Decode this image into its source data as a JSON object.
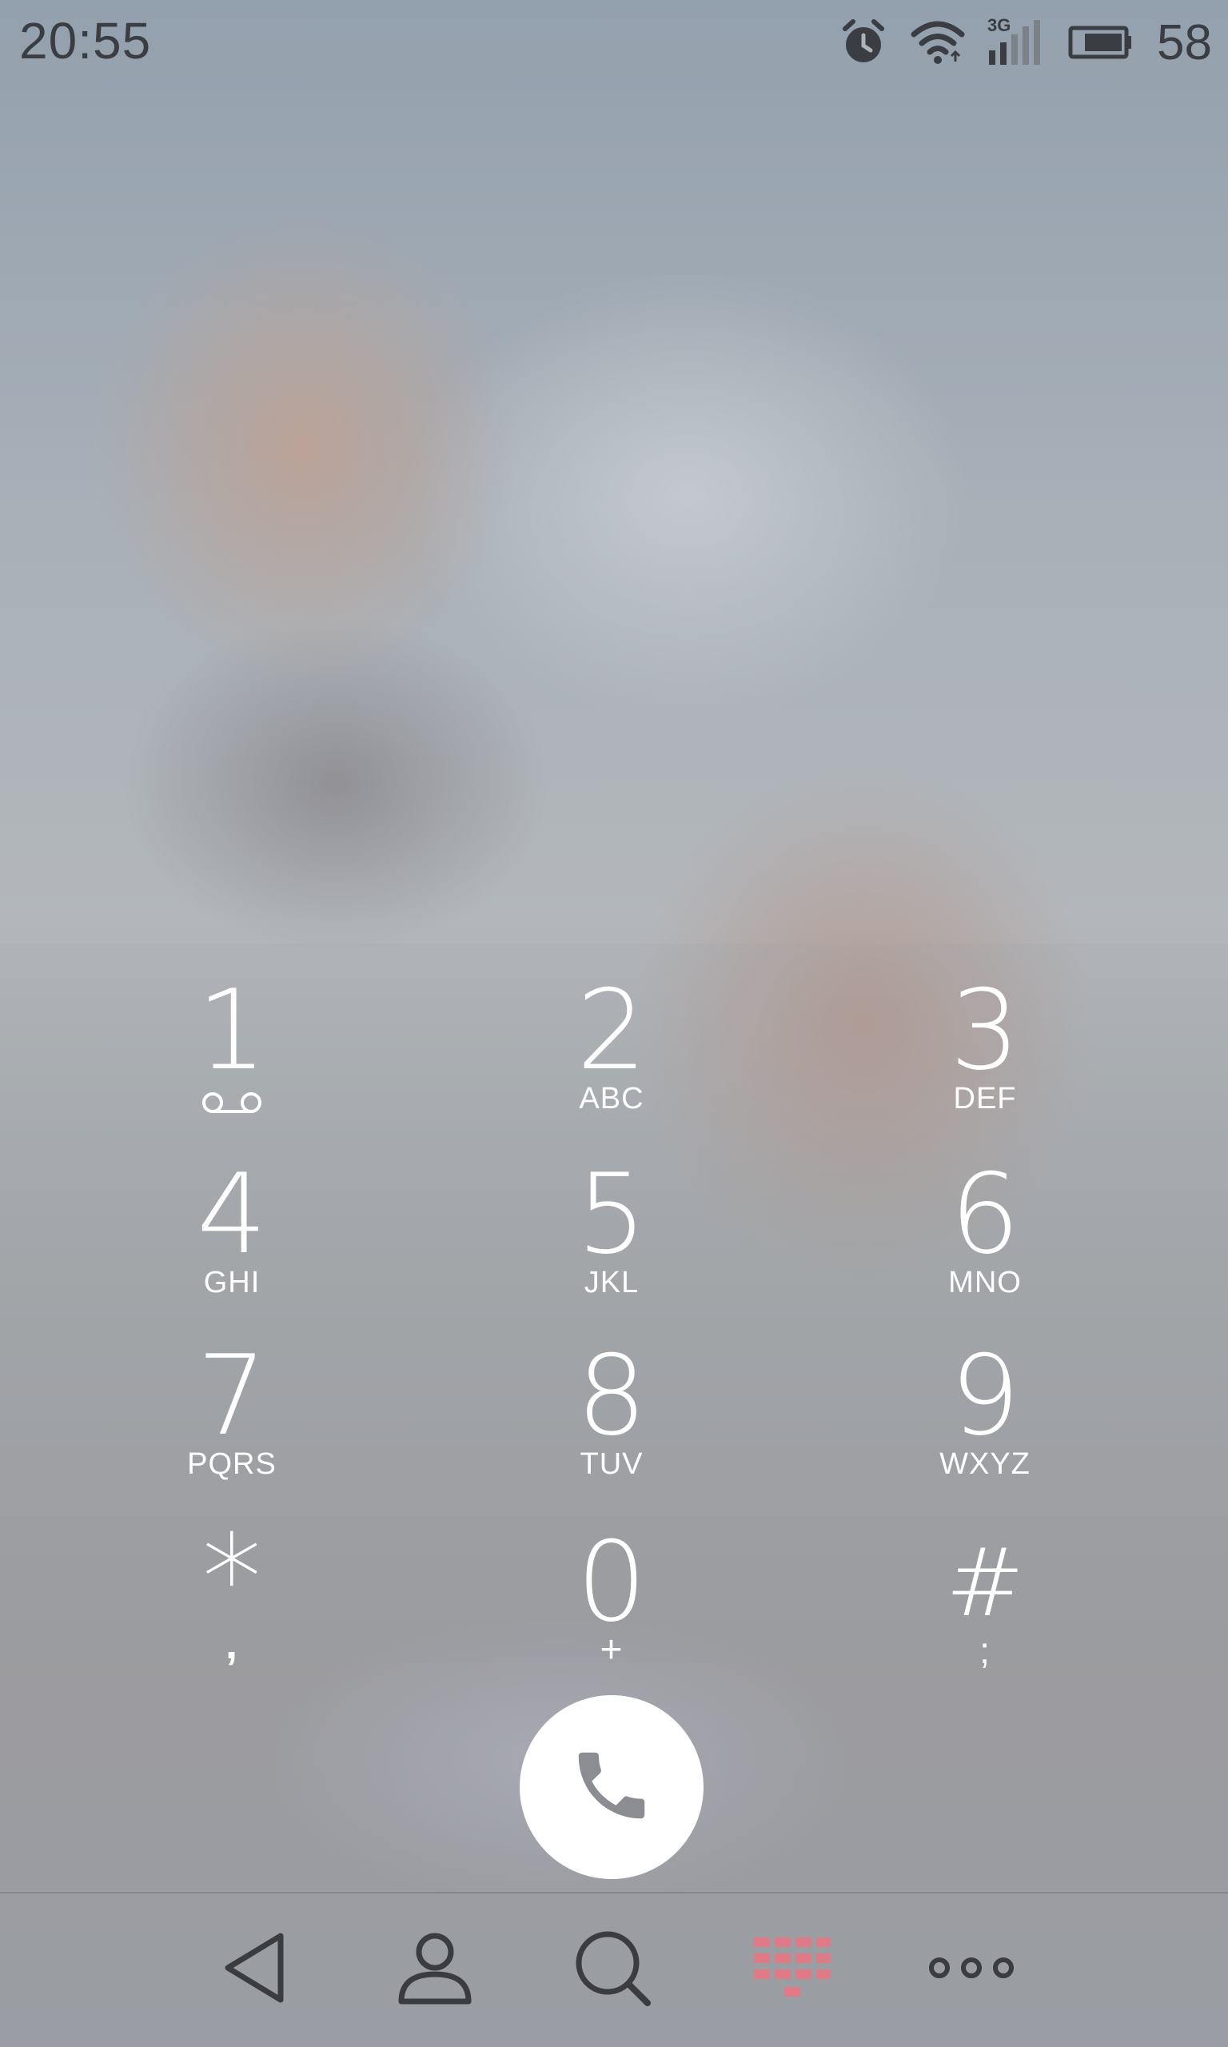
{
  "status_bar": {
    "time": "20:55",
    "icons": [
      "alarm-icon",
      "wifi-icon",
      "signal-3g-icon",
      "battery-icon"
    ],
    "network_label": "3G",
    "battery_percent": "58"
  },
  "keypad": {
    "keys": [
      {
        "digit": "1",
        "letters": "",
        "icon": "voicemail-icon"
      },
      {
        "digit": "2",
        "letters": "ABC"
      },
      {
        "digit": "3",
        "letters": "DEF"
      },
      {
        "digit": "4",
        "letters": "GHI"
      },
      {
        "digit": "5",
        "letters": "JKL"
      },
      {
        "digit": "6",
        "letters": "MNO"
      },
      {
        "digit": "7",
        "letters": "PQRS"
      },
      {
        "digit": "8",
        "letters": "TUV"
      },
      {
        "digit": "9",
        "letters": "WXYZ"
      },
      {
        "digit": "*",
        "letters": ","
      },
      {
        "digit": "0",
        "letters": "+"
      },
      {
        "digit": "#",
        "letters": ";"
      }
    ]
  },
  "call_button": {
    "icon": "phone-icon"
  },
  "navbar": {
    "items": [
      {
        "icon": "back-icon"
      },
      {
        "icon": "contacts-icon"
      },
      {
        "icon": "search-icon"
      },
      {
        "icon": "dialpad-icon",
        "active": true
      },
      {
        "icon": "more-icon"
      }
    ],
    "accent_color": "#e07a86",
    "icon_color": "#3b3c40"
  }
}
